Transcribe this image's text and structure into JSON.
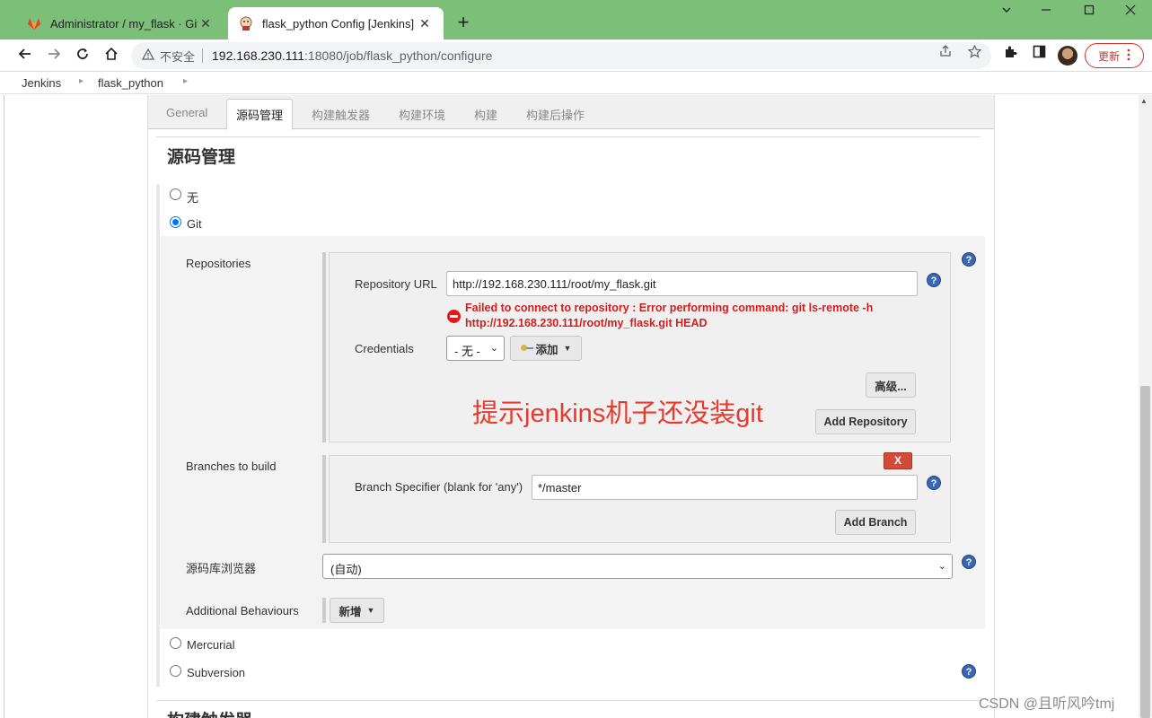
{
  "browser": {
    "tabs": [
      {
        "title": "Administrator / my_flask · GitLab",
        "icon": "gitlab-icon"
      },
      {
        "title": "flask_python Config [Jenkins]",
        "icon": "jenkins-icon"
      }
    ],
    "tab_close": "✕",
    "new_tab": "+",
    "address": {
      "insecure_label": "不安全",
      "host": "192.168.230.111",
      "rest": ":18080/job/flask_python/configure"
    },
    "update_label": "更新"
  },
  "breadcrumbs": [
    "Jenkins",
    "flask_python"
  ],
  "config_tabs": [
    "General",
    "源码管理",
    "构建触发器",
    "构建环境",
    "构建",
    "构建后操作"
  ],
  "active_tab": "源码管理",
  "scm": {
    "section_title": "源码管理",
    "options": {
      "none": "无",
      "git": "Git",
      "mercurial": "Mercurial",
      "subversion": "Subversion"
    },
    "selected": "git",
    "repositories_label": "Repositories",
    "repo_url_label": "Repository URL",
    "repo_url_value": "http://192.168.230.111/root/my_flask.git",
    "error_line1": "Failed to connect to repository : Error performing command: git ls-remote -h",
    "error_line2": "http://192.168.230.111/root/my_flask.git HEAD",
    "credentials_label": "Credentials",
    "credentials_value": "- 无 -",
    "add_credentials_label": "添加",
    "advanced_label": "高级...",
    "add_repository_label": "Add Repository",
    "branches_label": "Branches to build",
    "delete_label": "X",
    "branch_spec_label": "Branch Specifier (blank for 'any')",
    "branch_spec_value": "*/master",
    "add_branch_label": "Add Branch",
    "browser_label": "源码库浏览器",
    "browser_value": "(自动)",
    "additional_label": "Additional Behaviours",
    "add_behaviour_label": "新增"
  },
  "next_section_title": "构建触发器",
  "annotation": "提示jenkins机子还没装git",
  "watermark": "CSDN @且听风吟tmj",
  "colors": {
    "chrome_green": "#7cbf78",
    "error_red": "#d31e1e",
    "help_blue": "#3a66b3",
    "annotation_red": "#e8392c"
  }
}
